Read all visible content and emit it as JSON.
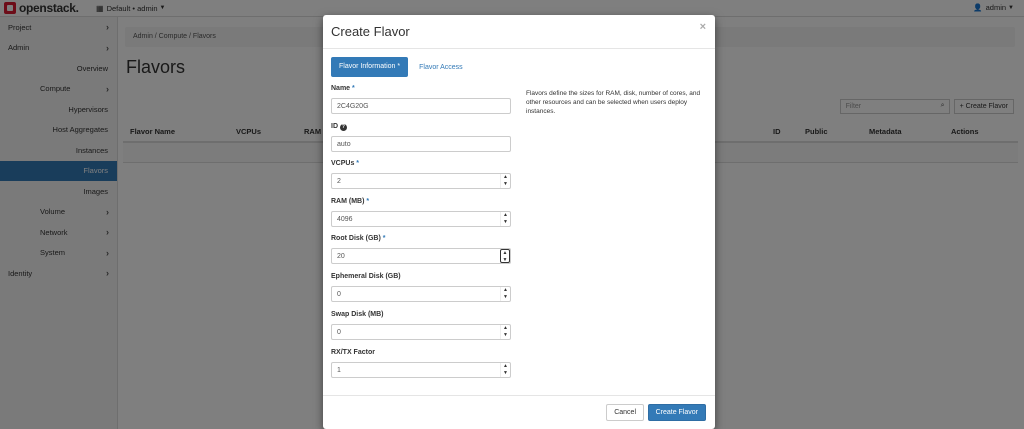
{
  "navbar": {
    "logo_text": "openstack.",
    "project_switch": "Default • admin",
    "user": "admin"
  },
  "sidebar": {
    "items": [
      {
        "label": "Project",
        "level": 1,
        "chevron": true
      },
      {
        "label": "Admin",
        "level": 1,
        "chevron": true
      },
      {
        "label": "Overview",
        "level": 3
      },
      {
        "label": "Compute",
        "level": 2,
        "chevron": true
      },
      {
        "label": "Hypervisors",
        "level": 3
      },
      {
        "label": "Host Aggregates",
        "level": 3
      },
      {
        "label": "Instances",
        "level": 3
      },
      {
        "label": "Flavors",
        "level": 3,
        "active": true
      },
      {
        "label": "Images",
        "level": 3
      },
      {
        "label": "Volume",
        "level": 2,
        "chevron": true
      },
      {
        "label": "Network",
        "level": 2,
        "chevron": true
      },
      {
        "label": "System",
        "level": 2,
        "chevron": true
      },
      {
        "label": "Identity",
        "level": 1,
        "chevron": true
      }
    ]
  },
  "main": {
    "breadcrumb": "Admin / Compute / Flavors",
    "title": "Flavors",
    "filter_placeholder": "Filter",
    "create_button": "+ Create Flavor",
    "columns": [
      "Flavor Name",
      "VCPUs",
      "RAM",
      "ID",
      "Public",
      "Metadata",
      "Actions"
    ]
  },
  "modal": {
    "title": "Create Flavor",
    "close": "×",
    "tabs": {
      "active": "Flavor Information",
      "active_marker": "*",
      "other": "Flavor Access"
    },
    "help": "Flavors define the sizes for RAM, disk, number of cores, and other resources and can be selected when users deploy instances.",
    "fields": {
      "name": {
        "label": "Name",
        "required": "*",
        "value": "2C4G20G"
      },
      "id": {
        "label": "ID",
        "help_icon": "?",
        "value": "auto"
      },
      "vcpus": {
        "label": "VCPUs",
        "required": "*",
        "value": "2"
      },
      "ram": {
        "label": "RAM (MB)",
        "required": "*",
        "value": "4096"
      },
      "root_disk": {
        "label": "Root Disk (GB)",
        "required": "*",
        "value": "20"
      },
      "ephemeral": {
        "label": "Ephemeral Disk (GB)",
        "value": "0"
      },
      "swap": {
        "label": "Swap Disk (MB)",
        "value": "0"
      },
      "rxtx": {
        "label": "RX/TX Factor",
        "value": "1"
      }
    },
    "footer": {
      "cancel": "Cancel",
      "submit": "Create Flavor"
    }
  },
  "colors": {
    "primary": "#337ab7",
    "brand_red": "#da1a32"
  },
  "icons": {
    "project_switch": "table-icon",
    "user": "user-icon",
    "filter": "search-icon",
    "spinner_up": "caret-up-icon",
    "spinner_down": "caret-down-icon",
    "sidebar_chevron": "chevron-right-icon",
    "help": "question-circle-icon"
  }
}
